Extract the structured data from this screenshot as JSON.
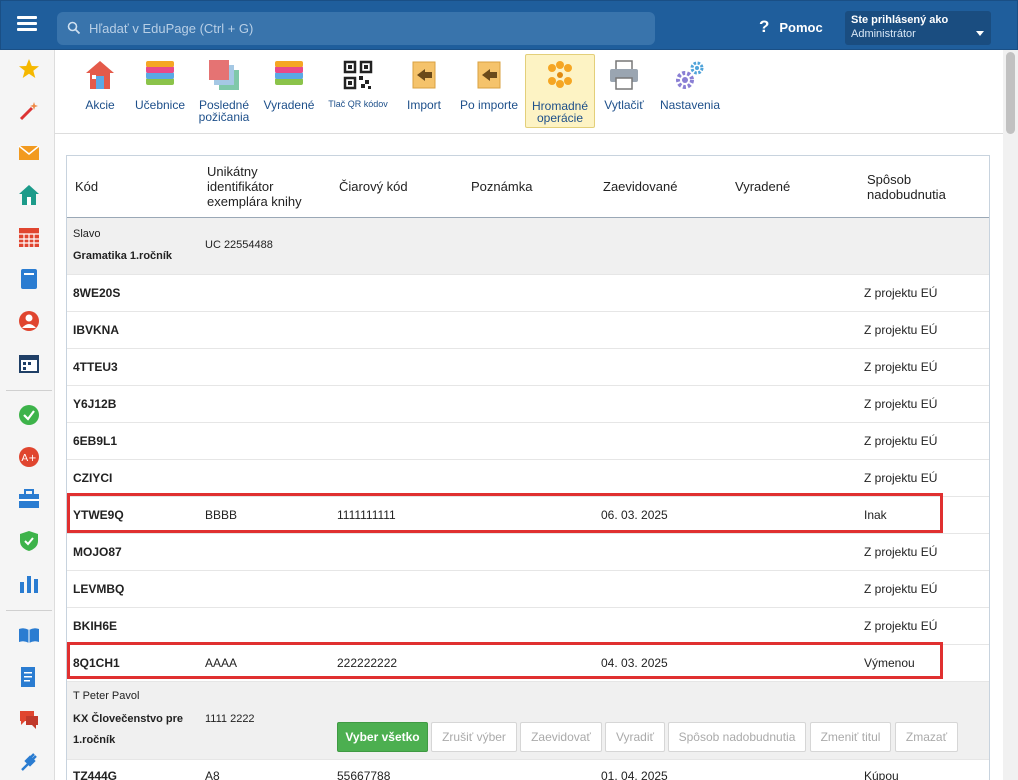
{
  "header": {
    "search_placeholder": "Hľadať v EduPage (Ctrl + G)",
    "help_label": "Pomoc",
    "user_line1": "Ste prihlásený ako",
    "user_line2": "Administrátor"
  },
  "toolbar": {
    "items": [
      {
        "label1": "Akcie",
        "label2": ""
      },
      {
        "label1": "Učebnice",
        "label2": ""
      },
      {
        "label1": "Posledné",
        "label2": "požičania"
      },
      {
        "label1": "Vyradené",
        "label2": ""
      },
      {
        "label1": "Tlač QR kódov",
        "label2": ""
      },
      {
        "label1": "Import",
        "label2": ""
      },
      {
        "label1": "Po importe",
        "label2": ""
      },
      {
        "label1": "Hromadné",
        "label2": "operácie"
      },
      {
        "label1": "Vytlačiť",
        "label2": ""
      },
      {
        "label1": "Nastavenia",
        "label2": ""
      }
    ]
  },
  "table": {
    "headers": {
      "kod": "Kód",
      "uid1": "Unikátny",
      "uid2": "identifikátor",
      "uid3": "exemplára knihy",
      "barcode": "Čiarový kód",
      "note": "Poznámka",
      "registered": "Zaevidované",
      "discarded": "Vyradené",
      "acq1": "Spôsob",
      "acq2": "nadobudnutia"
    },
    "group1": {
      "author": "Slavo",
      "title": "Gramatika 1.ročník",
      "uid": "UC 22554488"
    },
    "rows": [
      {
        "kod": "8WE20S",
        "uid": "",
        "barcode": "",
        "registered": "",
        "acq": "Z projektu EÚ"
      },
      {
        "kod": "IBVKNA",
        "uid": "",
        "barcode": "",
        "registered": "",
        "acq": "Z projektu EÚ"
      },
      {
        "kod": "4TTEU3",
        "uid": "",
        "barcode": "",
        "registered": "",
        "acq": "Z projektu EÚ"
      },
      {
        "kod": "Y6J12B",
        "uid": "",
        "barcode": "",
        "registered": "",
        "acq": "Z projektu EÚ"
      },
      {
        "kod": "6EB9L1",
        "uid": "",
        "barcode": "",
        "registered": "",
        "acq": "Z projektu EÚ"
      },
      {
        "kod": "CZIYCI",
        "uid": "",
        "barcode": "",
        "registered": "",
        "acq": "Z projektu EÚ"
      },
      {
        "kod": "YTWE9Q",
        "uid": "BBBB",
        "barcode": "1111111111",
        "registered": "06. 03. 2025",
        "acq": "Inak"
      },
      {
        "kod": "MOJO87",
        "uid": "",
        "barcode": "",
        "registered": "",
        "acq": "Z projektu EÚ"
      },
      {
        "kod": "LEVMBQ",
        "uid": "",
        "barcode": "",
        "registered": "",
        "acq": "Z projektu EÚ"
      },
      {
        "kod": "BKIH6E",
        "uid": "",
        "barcode": "",
        "registered": "",
        "acq": "Z projektu EÚ"
      },
      {
        "kod": "8Q1CH1",
        "uid": "AAAA",
        "barcode": "222222222",
        "registered": "04. 03. 2025",
        "acq": "Výmenou"
      }
    ],
    "group2": {
      "author": "T Peter Pavol",
      "title1": "KX Človečenstvo pre",
      "title2": "1.ročník",
      "uid": "1111 2222"
    },
    "partial_row": {
      "kod": "TZ444G",
      "uid": "A8",
      "barcode": "55667788",
      "registered": "01. 04. 2025",
      "acq": "Kúpou"
    }
  },
  "actions": {
    "select_all": "Vyber všetko",
    "cancel_selection": "Zrušiť výber",
    "register": "Zaevidovať",
    "discard": "Vyradiť",
    "acquisition": "Spôsob nadobudnutia",
    "change_title": "Zmeniť titul",
    "delete": "Zmazať"
  }
}
